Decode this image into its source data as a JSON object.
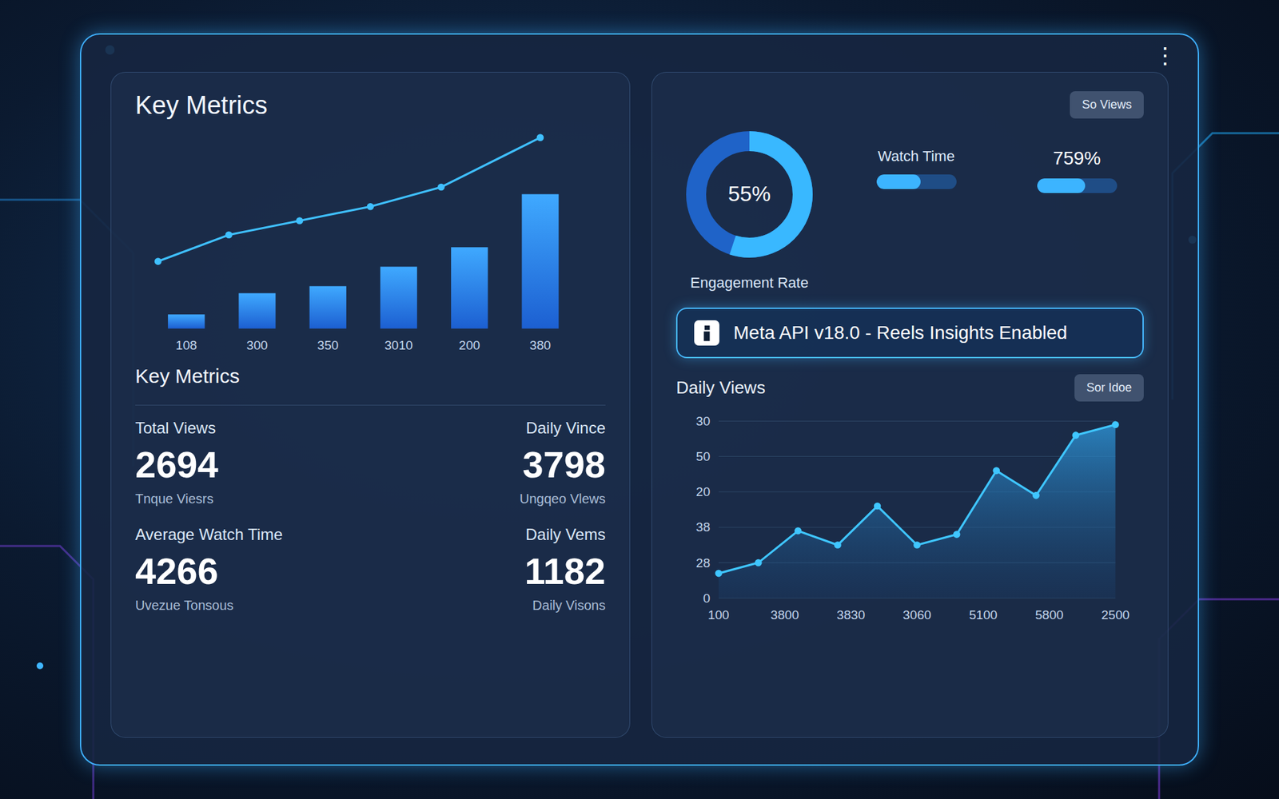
{
  "frame": {
    "menu": "⋮"
  },
  "growth_chart": {
    "title": "Key Metrics",
    "labels": [
      "108",
      "300",
      "350",
      "3010",
      "200",
      "380"
    ],
    "bars": [
      8,
      20,
      24,
      35,
      46,
      76
    ],
    "line": [
      30,
      45,
      53,
      61,
      72,
      100
    ],
    "max": 100
  },
  "metrics_section": {
    "title": "Key Metrics",
    "items": [
      {
        "label": "Total Views",
        "value": "2694",
        "caption": "Tnque Viesrs"
      },
      {
        "label": "Daily Vince",
        "value": "3798",
        "caption": "Ungqeo Vlews"
      },
      {
        "label": "Average Watch Time",
        "value": "4266",
        "caption": "Uvezue Tonsous"
      },
      {
        "label": "Daily Vems",
        "value": "1182",
        "caption": "Daily Visons"
      }
    ]
  },
  "top_button": "So Views",
  "engagement": {
    "value": "55%",
    "label": "Engagement Rate",
    "level": 0.55
  },
  "watch_time": {
    "label": "Watch Time",
    "level": 0.55
  },
  "percent_stat": {
    "value": "759%",
    "level": 0.6
  },
  "banner": {
    "text": "Meta API v18.0 - Reels Insights Enabled"
  },
  "daily_views": {
    "title": "Daily Views",
    "button": "Sor Idoe",
    "y_ticks": [
      "30",
      "50",
      "20",
      "38",
      "28",
      "0"
    ],
    "x_ticks": [
      "100",
      "3800",
      "3830",
      "3060",
      "5100",
      "5800",
      "2500"
    ],
    "values": [
      7,
      10,
      19,
      15,
      26,
      15,
      18,
      36,
      29,
      46,
      49
    ],
    "max": 50
  }
}
